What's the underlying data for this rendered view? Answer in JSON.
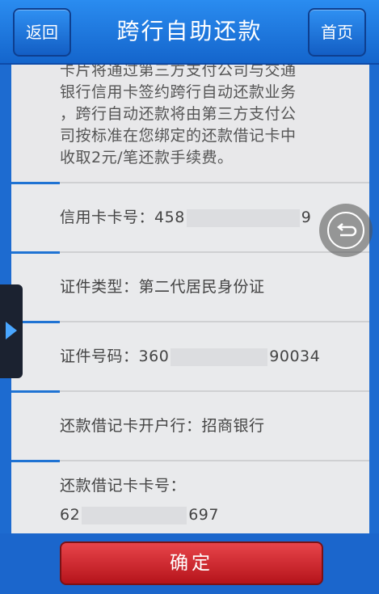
{
  "header": {
    "title": "跨行自助还款",
    "back_label": "返回",
    "home_label": "首页"
  },
  "notice": {
    "lines": [
      "卡片将通过第三方支付公司与交通",
      "银行信用卡签约跨行自动还款业务",
      "，跨行自动还款将由第三方支付公",
      "司按标准在您绑定的还款借记卡中",
      "收取2元/笔还款手续费。"
    ]
  },
  "fields": {
    "credit_card": {
      "label": "信用卡卡号：",
      "prefix": "458",
      "suffix": "9"
    },
    "id_type": {
      "label": "证件类型：",
      "value": "第二代居民身份证"
    },
    "id_number": {
      "label": "证件号码：",
      "prefix": "360",
      "suffix": "90034"
    },
    "debit_bank": {
      "label": "还款借记卡开户行：",
      "value": "招商银行"
    },
    "debit_card": {
      "label": "还款借记卡卡号：",
      "prefix": "62",
      "suffix": "697"
    }
  },
  "footer": {
    "confirm_label": "确定"
  },
  "colors": {
    "header_blue": "#1a6fd4",
    "accent_blue": "#1f73d3",
    "confirm_red": "#c8262d",
    "panel_bg": "#e9eaec"
  },
  "icons": {
    "side_tab": "chevron-right-icon",
    "floating": "undo-icon"
  }
}
